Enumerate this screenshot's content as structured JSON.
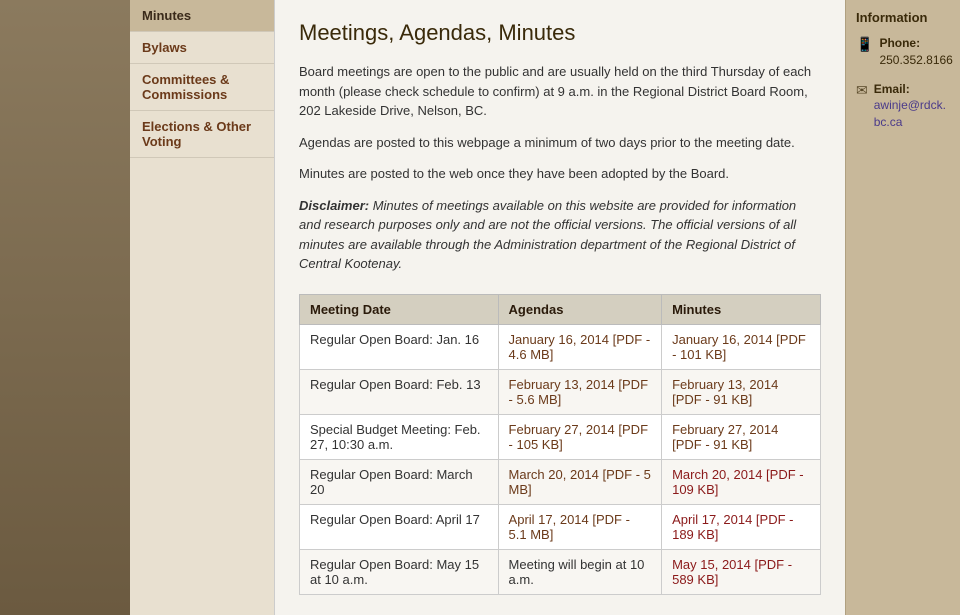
{
  "sidebar": {
    "background": "#7a6a50"
  },
  "nav": {
    "active_item": "Minutes",
    "items": [
      {
        "label": "Bylaws",
        "href": "#"
      },
      {
        "label": "Committees & Commissions",
        "href": "#"
      },
      {
        "label": "Elections & Other Voting",
        "href": "#"
      }
    ]
  },
  "main": {
    "title": "Meetings, Agendas, Minutes",
    "paragraphs": [
      "Board meetings are open to the public and are usually held on the third Thursday of each month (please check schedule to confirm) at 9 a.m. in the Regional District Board Room, 202 Lakeside Drive, Nelson, BC.",
      "Agendas are posted to this webpage a minimum of two days prior to the meeting date.",
      "Minutes are posted to the web once they have been adopted by the Board."
    ],
    "disclaimer_label": "Disclaimer:",
    "disclaimer_text": " Minutes of meetings available on this website are provided for information and research purposes only and are not the official versions. The official versions of all minutes are available through the Administration department of the Regional District of Central Kootenay.",
    "table": {
      "headers": [
        "Meeting Date",
        "Agendas",
        "Minutes"
      ],
      "rows": [
        {
          "date": "Regular Open Board: Jan. 16",
          "agenda": "January 16, 2014 [PDF - 4.6 MB]",
          "agenda_href": "#",
          "minutes": "January 16, 2014 [PDF - 101 KB]",
          "minutes_href": "#",
          "minutes_color": "normal"
        },
        {
          "date": "Regular Open Board: Feb. 13",
          "agenda": "February 13, 2014 [PDF - 5.6 MB]",
          "agenda_href": "#",
          "minutes": "February 13, 2014 [PDF - 91 KB]",
          "minutes_href": "#",
          "minutes_color": "normal"
        },
        {
          "date": "Special Budget Meeting: Feb. 27, 10:30 a.m.",
          "agenda": "February 27, 2014 [PDF - 105 KB]",
          "agenda_href": "#",
          "minutes": "February 27, 2014 [PDF - 91 KB]",
          "minutes_href": "#",
          "minutes_color": "normal"
        },
        {
          "date": "Regular Open Board: March 20",
          "agenda": "March 20, 2014 [PDF - 5 MB]",
          "agenda_href": "#",
          "minutes": "March 20, 2014 [PDF - 109 KB]",
          "minutes_href": "#",
          "minutes_color": "red"
        },
        {
          "date": "Regular Open Board: April 17",
          "agenda": "April 17, 2014 [PDF - 5.1 MB]",
          "agenda_href": "#",
          "minutes": "April 17, 2014 [PDF - 189 KB]",
          "minutes_href": "#",
          "minutes_color": "red"
        },
        {
          "date": "Regular Open Board: May 15 at 10 a.m.",
          "agenda": "Meeting will begin at 10 a.m.",
          "agenda_href": "#",
          "minutes": "May 15, 2014 [PDF - 589 KB]",
          "minutes_href": "#",
          "minutes_color": "red"
        }
      ]
    }
  },
  "info_panel": {
    "title": "Information",
    "phone_label": "Phone:",
    "phone_number": "250.352.8166",
    "email_label": "Email:",
    "email_address": "awinje@rdck.bc.ca"
  }
}
